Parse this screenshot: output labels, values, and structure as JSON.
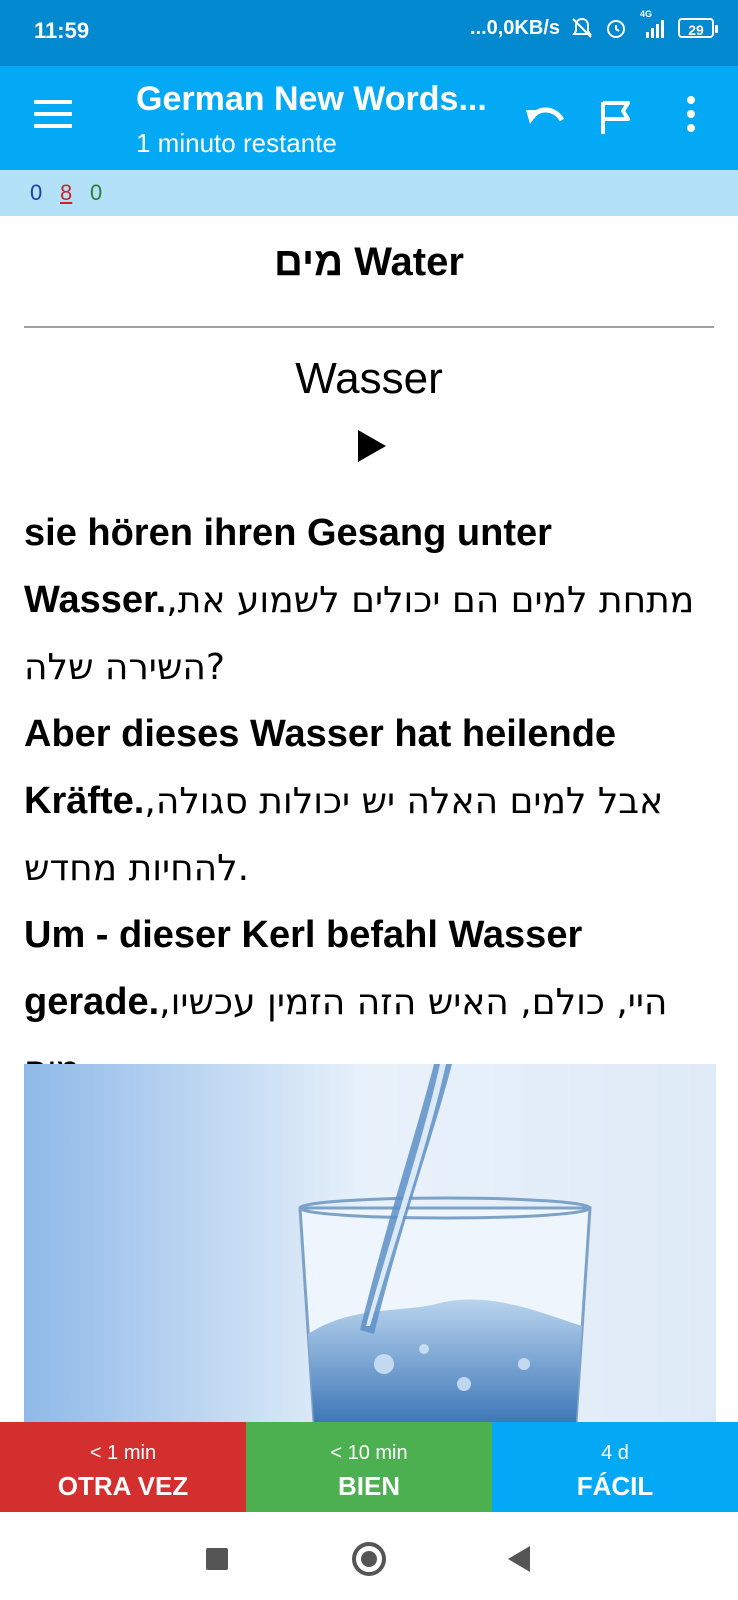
{
  "status_bar": {
    "time": "11:59",
    "network_speed": "...0,0KB/s",
    "network_type": "4G",
    "battery": "29"
  },
  "app_bar": {
    "title": "German New Words...",
    "subtitle": "1 minuto restante",
    "icons": [
      "menu-icon",
      "undo-icon",
      "flag-icon",
      "more-vert-icon"
    ]
  },
  "counts": {
    "new": "0",
    "learning": "8",
    "review": "0"
  },
  "card": {
    "front": "מים Water",
    "answer": "Wasser",
    "examples": [
      {
        "de": "sie hören ihren Gesang unter Wasser.",
        "he": ",מתחת למים הם יכולים לשמוע את השירה שלה?"
      },
      {
        "de": "Aber dieses Wasser hat heilende Kräfte.",
        "he": ",אבל למים האלה יש יכולות סגולה להחיות מחדש."
      },
      {
        "de": "Um - dieser Kerl befahl Wasser gerade.",
        "he": ",היי, כולם, האיש הזה הזמין עכשיו מים."
      }
    ]
  },
  "answer_buttons": [
    {
      "interval": "< 1 min",
      "label": "OTRA VEZ",
      "color": "#d32f2f"
    },
    {
      "interval": "< 10 min",
      "label": "BIEN",
      "color": "#4caf50"
    },
    {
      "interval": "4 d",
      "label": "FÁCIL",
      "color": "#03a9f4"
    }
  ],
  "colors": {
    "status_bar": "#0289cf",
    "app_bar": "#03a9f4",
    "counts_bar": "#b3e2f8"
  }
}
